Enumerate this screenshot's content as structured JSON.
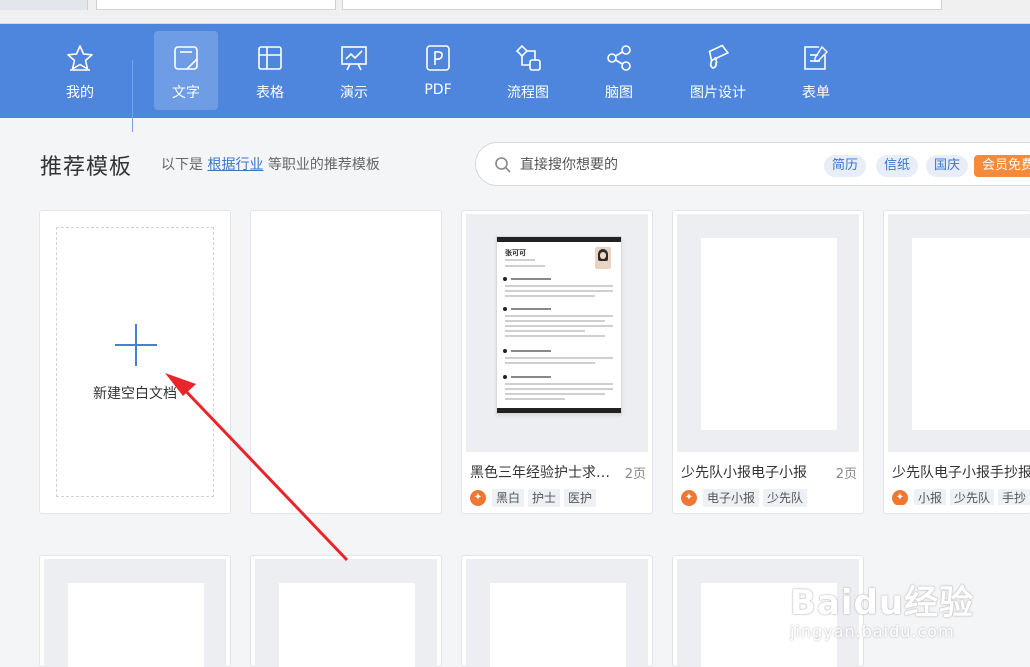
{
  "toolbar": {
    "items": [
      {
        "label": "我的",
        "icon": "star-icon"
      },
      {
        "label": "文字",
        "icon": "document-icon",
        "active": true
      },
      {
        "label": "表格",
        "icon": "table-icon"
      },
      {
        "label": "演示",
        "icon": "presentation-icon"
      },
      {
        "label": "PDF",
        "icon": "pdf-icon"
      },
      {
        "label": "流程图",
        "icon": "flowchart-icon"
      },
      {
        "label": "脑图",
        "icon": "mindmap-icon"
      },
      {
        "label": "图片设计",
        "icon": "image-design-icon"
      },
      {
        "label": "表单",
        "icon": "form-icon"
      }
    ],
    "color": "#4e86dd"
  },
  "section": {
    "title": "推荐模板",
    "subtitle_prefix": "以下是",
    "subtitle_link": "根据行业",
    "subtitle_suffix": "等职业的推荐模板"
  },
  "search": {
    "placeholder": "直接搜你想要的",
    "chips": [
      "简历",
      "信纸",
      "国庆"
    ],
    "vip_chip": "会员免费"
  },
  "new_doc": {
    "label": "新建空白文档"
  },
  "templates": [
    {
      "title": "黑色三年经验护士求职...",
      "pages": "2页",
      "tags": [
        "黑白",
        "护士",
        "医护"
      ]
    },
    {
      "title": "少先队小报电子小报",
      "pages": "2页",
      "tags": [
        "电子小报",
        "少先队"
      ]
    },
    {
      "title": "少先队电子小报手抄报",
      "pages": "",
      "tags": [
        "小报",
        "少先队",
        "手抄"
      ]
    }
  ],
  "resume_name": "张可可",
  "watermark": {
    "main": "Baidu经验",
    "sub": "jingyan.baidu.com"
  }
}
